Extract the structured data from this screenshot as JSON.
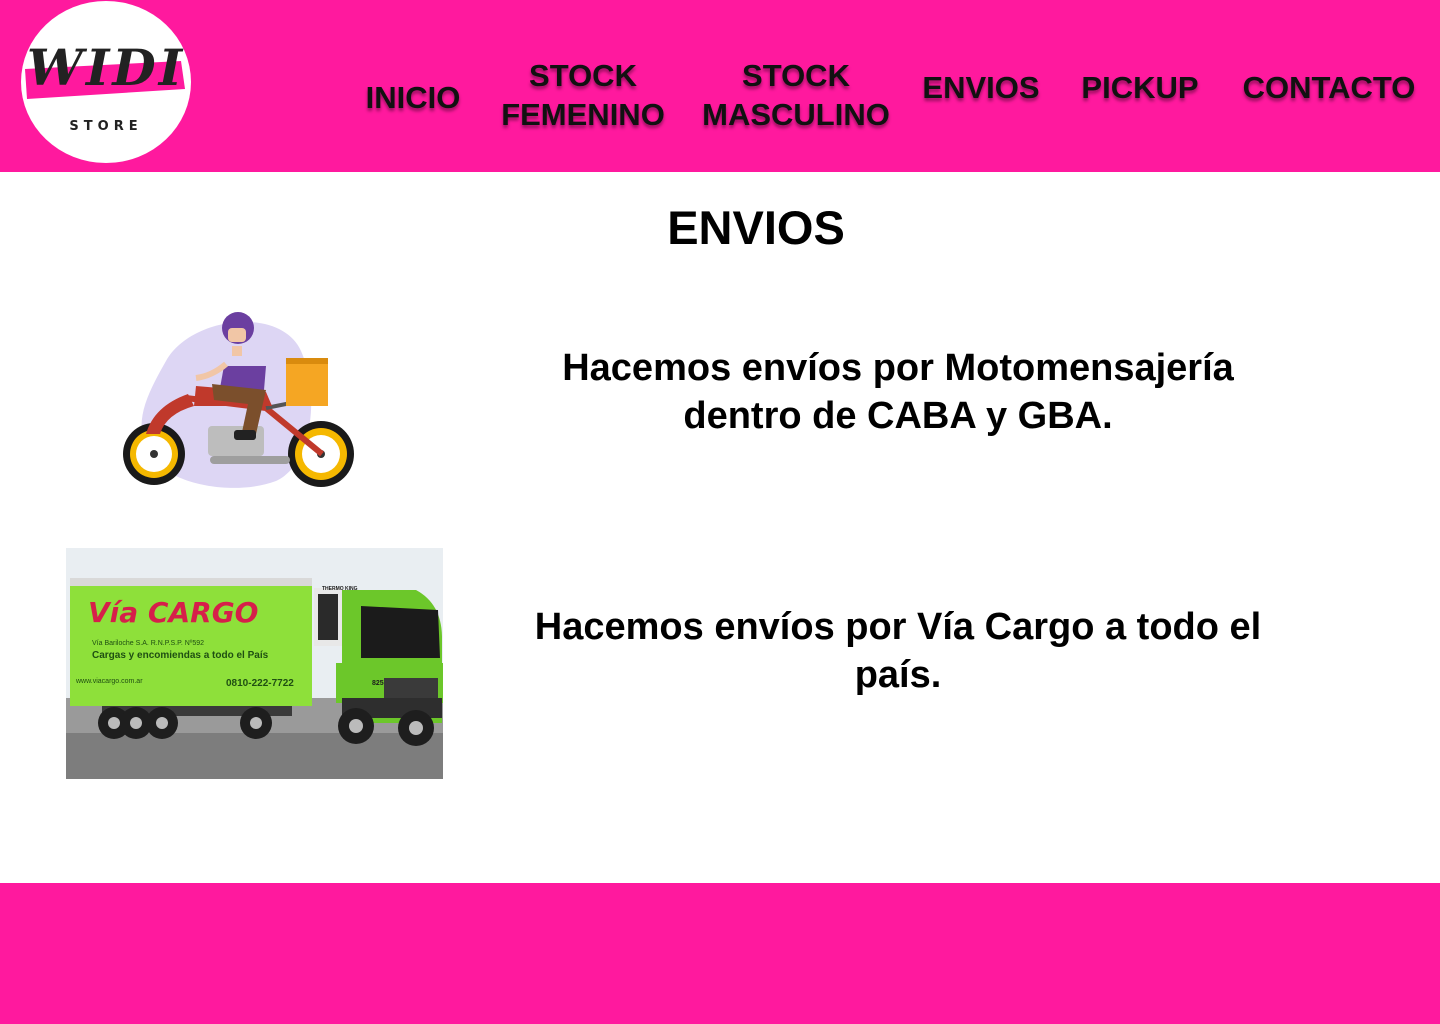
{
  "brand": {
    "name": "WIDI",
    "sub": "STORE",
    "accent": "#ff199e"
  },
  "nav": {
    "items": [
      {
        "label": "INICIO"
      },
      {
        "label": "STOCK FEMENINO",
        "line1": "STOCK",
        "line2": "FEMENINO"
      },
      {
        "label": "STOCK MASCULINO",
        "line1": "STOCK",
        "line2": "MASCULINO"
      },
      {
        "label": "ENVIOS"
      },
      {
        "label": "PICKUP"
      },
      {
        "label": "CONTACTO"
      }
    ]
  },
  "main": {
    "title": "ENVIOS",
    "rows": [
      {
        "text": "Hacemos envíos por Motomensajería dentro de CABA y GBA.",
        "image": "motorcycle-courier-illustration"
      },
      {
        "text": "Hacemos envíos por Vía Cargo a todo el país.",
        "image": "via-cargo-truck-photo"
      }
    ]
  },
  "truck_photo": {
    "brand": "Vía CARGO",
    "company_line": "Vía Bariloche S.A. R.N.P.S.P. Nº592",
    "slogan": "Cargas y encomiendas a todo el País",
    "website": "www.viacargo.com.ar",
    "phone": "0810-222-7722",
    "reefer_brand": "THERMO KING",
    "unit_number": "825"
  },
  "colors": {
    "header_bg": "#ff199e",
    "footer_bg": "#ff199e",
    "truck_green": "#7ddc2e",
    "courier_purple": "#6b3fa0",
    "box_orange": "#f5a623"
  }
}
